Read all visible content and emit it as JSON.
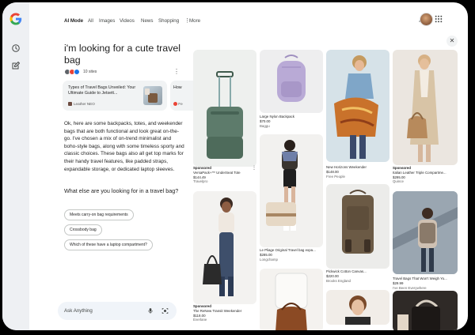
{
  "nav": {
    "tabs": [
      {
        "label": "AI Mode",
        "active": true
      },
      {
        "label": "All"
      },
      {
        "label": "Images"
      },
      {
        "label": "Videos"
      },
      {
        "label": "News"
      },
      {
        "label": "Shopping"
      },
      {
        "label": "More"
      }
    ]
  },
  "colors": {
    "accent": "#1a73e8",
    "chip_border": "#c4c7c5",
    "rail": "#eef0f3"
  },
  "conversation": {
    "query": "i'm looking for a cute travel bag",
    "sites_count": "10 sites",
    "sources": [
      {
        "title": "Types of Travel Bags Unveiled: Your Ultimate Guide to Jetsett...",
        "publisher": "Leather NEO"
      },
      {
        "title": "How",
        "publisher": "Fe"
      }
    ],
    "answer": "Ok, here are some backpacks, totes, and weekender bags that are both functional and look great on-the-go. I've chosen a mix of on-trend minimalist and boho-style bags, along with some timeless sporty and classic choices. These bags also all get top marks for their handy travel features, like padded straps, expandable storage, or dedicated laptop sleeves.",
    "followup_question": "What else are you looking for in a travel bag?",
    "suggestions": [
      "Meets carry-on bag requirements",
      "Crossbody bag",
      "Which of these have a laptop compartment?"
    ]
  },
  "ask": {
    "placeholder": "Ask Anything"
  },
  "products": [
    {
      "sponsored": "Sponsored",
      "name": "VersaPack+™ UnderSeat Tote",
      "price": "$144.49",
      "store": "Travelpro"
    },
    {
      "sponsored": "Sponsored",
      "name": "The ReNew Transit Weekender",
      "price": "$118.00",
      "store": "Everlane"
    },
    {
      "name": "Large Nylon Backpack",
      "price": "$70.00",
      "store": "Baggu"
    },
    {
      "name": "Le Pliage Original Travel bag expa...",
      "price": "$285.00",
      "store": "Longchamp"
    },
    {
      "name": "New Horizons Weekender",
      "price": "$148.00",
      "store": "Free People"
    },
    {
      "name": "Pickwick Cotton Canvas...",
      "price": "$220.00",
      "store": "Brooks England"
    },
    {
      "sponsored": "Sponsored",
      "name": "Italian Leather Triple Compartme...",
      "price": "$295.00",
      "store": "Quince"
    },
    {
      "name": "Travel Bags That Won't Weigh Yo...",
      "price": "$29.99",
      "store": "I've Been Everywhere"
    }
  ]
}
